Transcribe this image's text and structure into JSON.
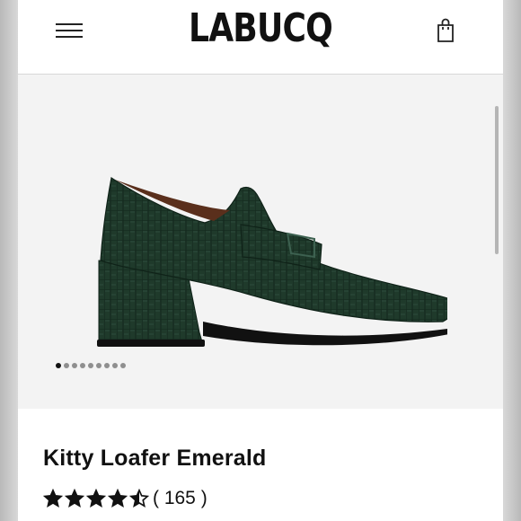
{
  "header": {
    "brand": "LABUCQ",
    "menu_icon": "hamburger-menu-icon",
    "cart_icon": "shopping-bag-icon"
  },
  "product": {
    "title": "Kitty Loafer Emerald",
    "image_icon": "green-croc-heeled-loafer-image",
    "rating": 4.5,
    "review_count": "( 165 )"
  },
  "carousel": {
    "total": 9,
    "active_index": 0
  },
  "colors": {
    "shoe": "#1f3a2b",
    "sole": "#111111",
    "hero_bg": "#f3f3f3"
  }
}
